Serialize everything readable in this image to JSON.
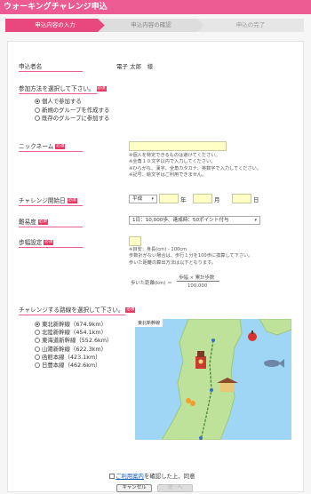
{
  "title": "ウォーキングチャレンジ申込",
  "steps": [
    "申込内容の入力",
    "申込内容の確認",
    "申込の完了"
  ],
  "applicant": {
    "label": "申込者名",
    "value": "電子 太郎　様"
  },
  "participation": {
    "label": "参加方法を選択して下さい。",
    "required": "必須",
    "options": [
      "個人で参加する",
      "新規のグループを作成する",
      "既存のグループに参加する"
    ],
    "selected_index": 0
  },
  "nickname": {
    "label": "ニックネーム",
    "required": "必須",
    "value": "",
    "notes": [
      "※個人を特定できるものは避けてください。",
      "※全角１０文字以内で入力してください。",
      "※ひらがな、漢字、全角カタカナ、英数字で入力してください。",
      "※記号、絵文字はご利用できません。"
    ]
  },
  "start_date": {
    "label": "チャレンジ開始日",
    "required": "必須",
    "era": "平成",
    "year_unit": "年",
    "month_unit": "月",
    "day_unit": "日"
  },
  "difficulty": {
    "label": "難易度",
    "required": "必須",
    "selected": "1日：10,000歩、達成時：50ポイント付与"
  },
  "stride": {
    "label": "歩幅設定",
    "required": "必須",
    "value": "",
    "notes": [
      "※目安：身長(cm) - 100cm",
      "歩数計がない場合は、歩行１分を100歩に換算して下さい。",
      "歩いた距離の算出方法は以下となります。"
    ],
    "formula_left": "歩いた距離(km) ＝",
    "formula_numerator": "歩幅 × 累計歩数",
    "formula_denominator": "100,000"
  },
  "route": {
    "label": "チャレンジする路線を選択して下さい。",
    "required": "必須",
    "options": [
      "東北新幹線（674.9km）",
      "北陸新幹線（454.1km）",
      "東海道新幹線（552.6km）",
      "山陽新幹線（622.3km）",
      "函館本線（423.1km）",
      "日豊本線（462.6km）"
    ],
    "selected_index": 0,
    "map_label": "東北新幹線"
  },
  "consent": {
    "prefix": "",
    "link": "ご利用案内",
    "suffix": "を確認した上、同意"
  },
  "buttons": {
    "cancel": "キャンセル",
    "next": "次　へ"
  },
  "colors": {
    "accent": "#ec5b91",
    "required": "#e73a63",
    "input": "#ffffc6",
    "sea": "#9fd6f5",
    "land": "#bfe29b"
  }
}
